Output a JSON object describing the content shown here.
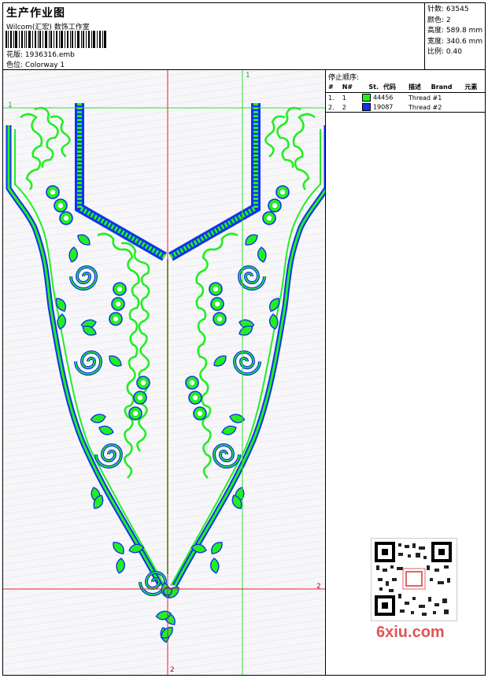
{
  "header": {
    "title": "生产作业图",
    "company": "Wilcom(汇宏) 数饰工作室",
    "file_label": "花版:",
    "file_name": "1936316.emb",
    "colorway_label": "色位:",
    "colorway": "Colorway 1"
  },
  "stats": [
    {
      "label": "针数:",
      "value": "63545"
    },
    {
      "label": "颜色:",
      "value": "2"
    },
    {
      "label": "高度:",
      "value": "589.8 mm"
    },
    {
      "label": "宽度:",
      "value": "340.6 mm"
    },
    {
      "label": "比例:",
      "value": "0.40"
    }
  ],
  "stop_sequence": {
    "title": "停止顺序:",
    "columns": [
      "#",
      "N#",
      "St.",
      "代码",
      "描述",
      "Brand",
      "元素"
    ],
    "rows": [
      {
        "idx": "1.",
        "n": "1",
        "color": "#22ee22",
        "code": "44456",
        "desc": "Thread #1"
      },
      {
        "idx": "2.",
        "n": "2",
        "color": "#1133ee",
        "code": "19087",
        "desc": "Thread #2"
      }
    ]
  },
  "guides": {
    "h1": "1",
    "v1": "1",
    "h2": "2",
    "v2": "2"
  },
  "watermark": "6xiu.com",
  "colors": {
    "green": "#22ee22",
    "blue": "#1133ee",
    "guide_red": "#ee2222",
    "guide_green": "#33dd33"
  }
}
